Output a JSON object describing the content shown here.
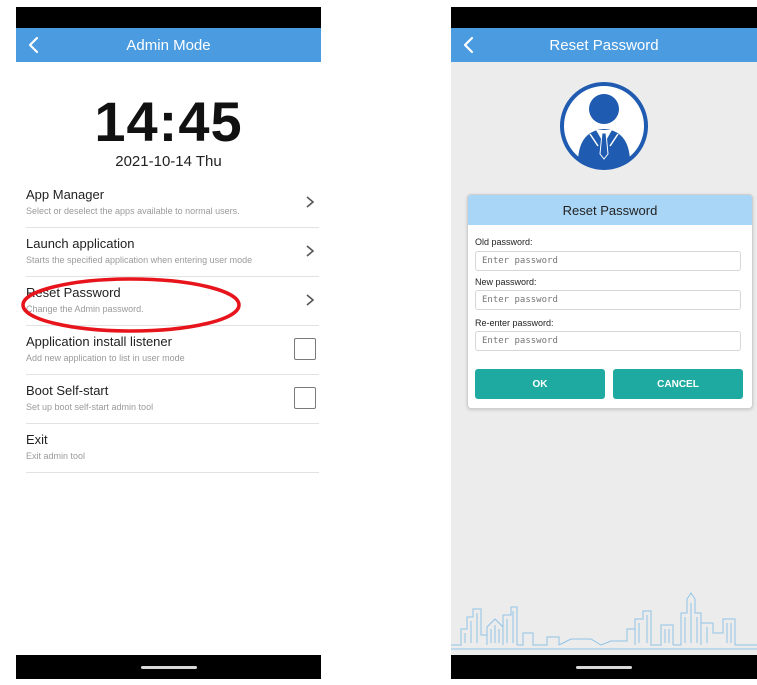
{
  "left_screen": {
    "title": "Admin Mode",
    "clock": "14:45",
    "date": "2021-10-14 Thu",
    "menu": [
      {
        "label": "App Manager",
        "desc": "Select or deselect the apps available to normal users.",
        "control": "chevron"
      },
      {
        "label": "Launch application",
        "desc": "Starts the specified application when entering user mode",
        "control": "chevron"
      },
      {
        "label": "Reset Password",
        "desc": "Change the Admin password.",
        "control": "chevron"
      },
      {
        "label": "Application install listener",
        "desc": "Add new application to list in user mode",
        "control": "checkbox",
        "checked": false
      },
      {
        "label": "Boot Self-start",
        "desc": "Set up boot self-start admin tool",
        "control": "checkbox",
        "checked": false
      },
      {
        "label": "Exit",
        "desc": "Exit admin tool",
        "control": "none"
      }
    ],
    "highlight_color": "#e8141c"
  },
  "right_screen": {
    "title": "Reset Password",
    "dialog": {
      "title": "Reset Password",
      "old_label": "Old password:",
      "old_placeholder": "Enter password",
      "new_label": "New password:",
      "new_placeholder": "Enter password",
      "reenter_label": "Re-enter password:",
      "reenter_placeholder": "Enter password",
      "ok": "OK",
      "cancel": "CANCEL"
    }
  },
  "colors": {
    "appbar": "#4a9be0",
    "dialog_header": "#a9d6f7",
    "button": "#1eaaa0",
    "avatar": "#1f5bb0"
  },
  "icons": {
    "back": "chevron-left-icon",
    "menu_arrow": "chevron-right-icon",
    "avatar": "businessman-avatar-icon"
  }
}
